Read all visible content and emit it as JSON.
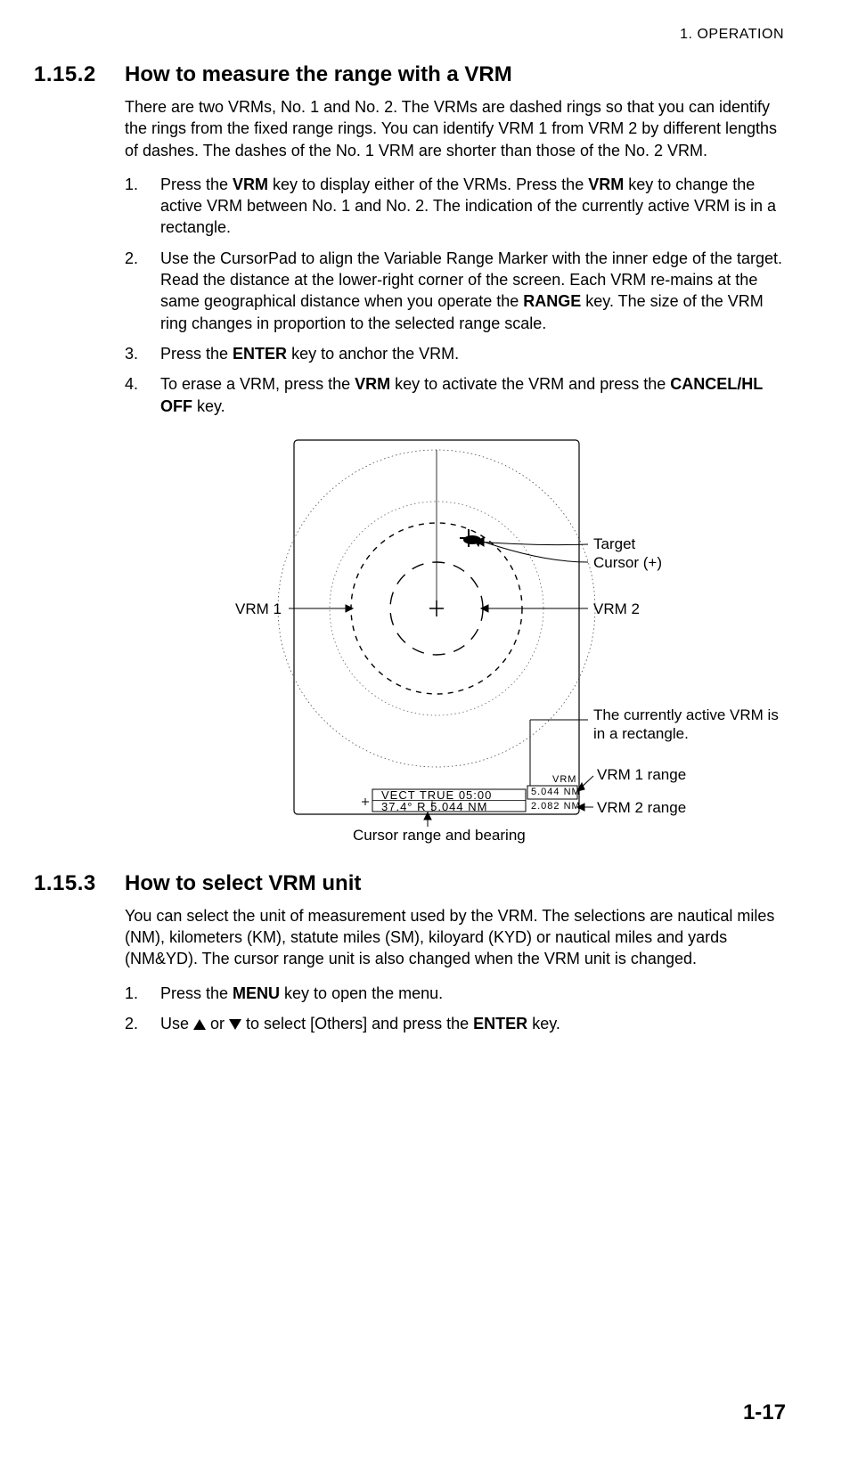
{
  "header": {
    "running": "1.  OPERATION"
  },
  "page_number": "1-17",
  "section_a": {
    "num": "1.15.2",
    "title": "How to measure the range with a VRM",
    "intro": "There are two VRMs, No. 1 and No. 2. The VRMs are dashed rings so that you can identify the rings from the fixed range rings. You can identify VRM 1 from VRM 2 by different lengths of dashes. The dashes of the No. 1 VRM are shorter than those of the No. 2 VRM.",
    "steps": {
      "s1a": "Press the ",
      "s1b": "VRM",
      "s1c": " key to display either of the VRMs. Press the ",
      "s1d": "VRM",
      "s1e": " key to change the active VRM between No. 1 and No. 2. The indication of the currently active VRM is in a rectangle.",
      "s2a": "Use the CursorPad to align the Variable Range Marker with the inner edge of the target. Read the distance at the lower-right corner of the screen. Each VRM re-mains at the same geographical distance when you operate the ",
      "s2b": "RANGE",
      "s2c": " key. The size of the VRM ring changes in proportion to the selected range scale.",
      "s3a": "Press the ",
      "s3b": "ENTER",
      "s3c": " key to anchor the VRM.",
      "s4a": "To erase a VRM, press the ",
      "s4b": "VRM",
      "s4c": " key to activate the VRM and press the ",
      "s4d": "CANCEL/HL OFF",
      "s4e": " key."
    }
  },
  "figure": {
    "labels": {
      "target": "Target",
      "cursor": "Cursor (+)",
      "vrm1": "VRM 1",
      "vrm2": "VRM 2",
      "active_note": "The currently active VRM is in a rectangle.",
      "vrm1_range": "VRM 1 range",
      "vrm2_range": "VRM 2 range",
      "cursor_rb": "Cursor range and bearing"
    },
    "readouts": {
      "vect_line": "VECT  TRUE   05:00",
      "bearing_range": "37.4° R     5.044 NM",
      "vrm_label": "VRM",
      "vrm1_val": "5.044 NM",
      "vrm2_val": "2.082 NM",
      "plus": "+"
    }
  },
  "section_b": {
    "num": "1.15.3",
    "title": "How to select VRM unit",
    "intro": "You can select the unit of measurement used by the VRM. The selections are nautical miles (NM), kilometers (KM), statute miles (SM), kiloyard (KYD) or nautical miles and yards (NM&YD). The cursor range unit is also changed when the VRM unit is changed.",
    "steps": {
      "s1a": "Press the ",
      "s1b": "MENU",
      "s1c": " key to open the menu.",
      "s2a": "Use ",
      "s2b": " or ",
      "s2c": " to select [Others] and press the ",
      "s2d": "ENTER",
      "s2e": " key."
    }
  }
}
